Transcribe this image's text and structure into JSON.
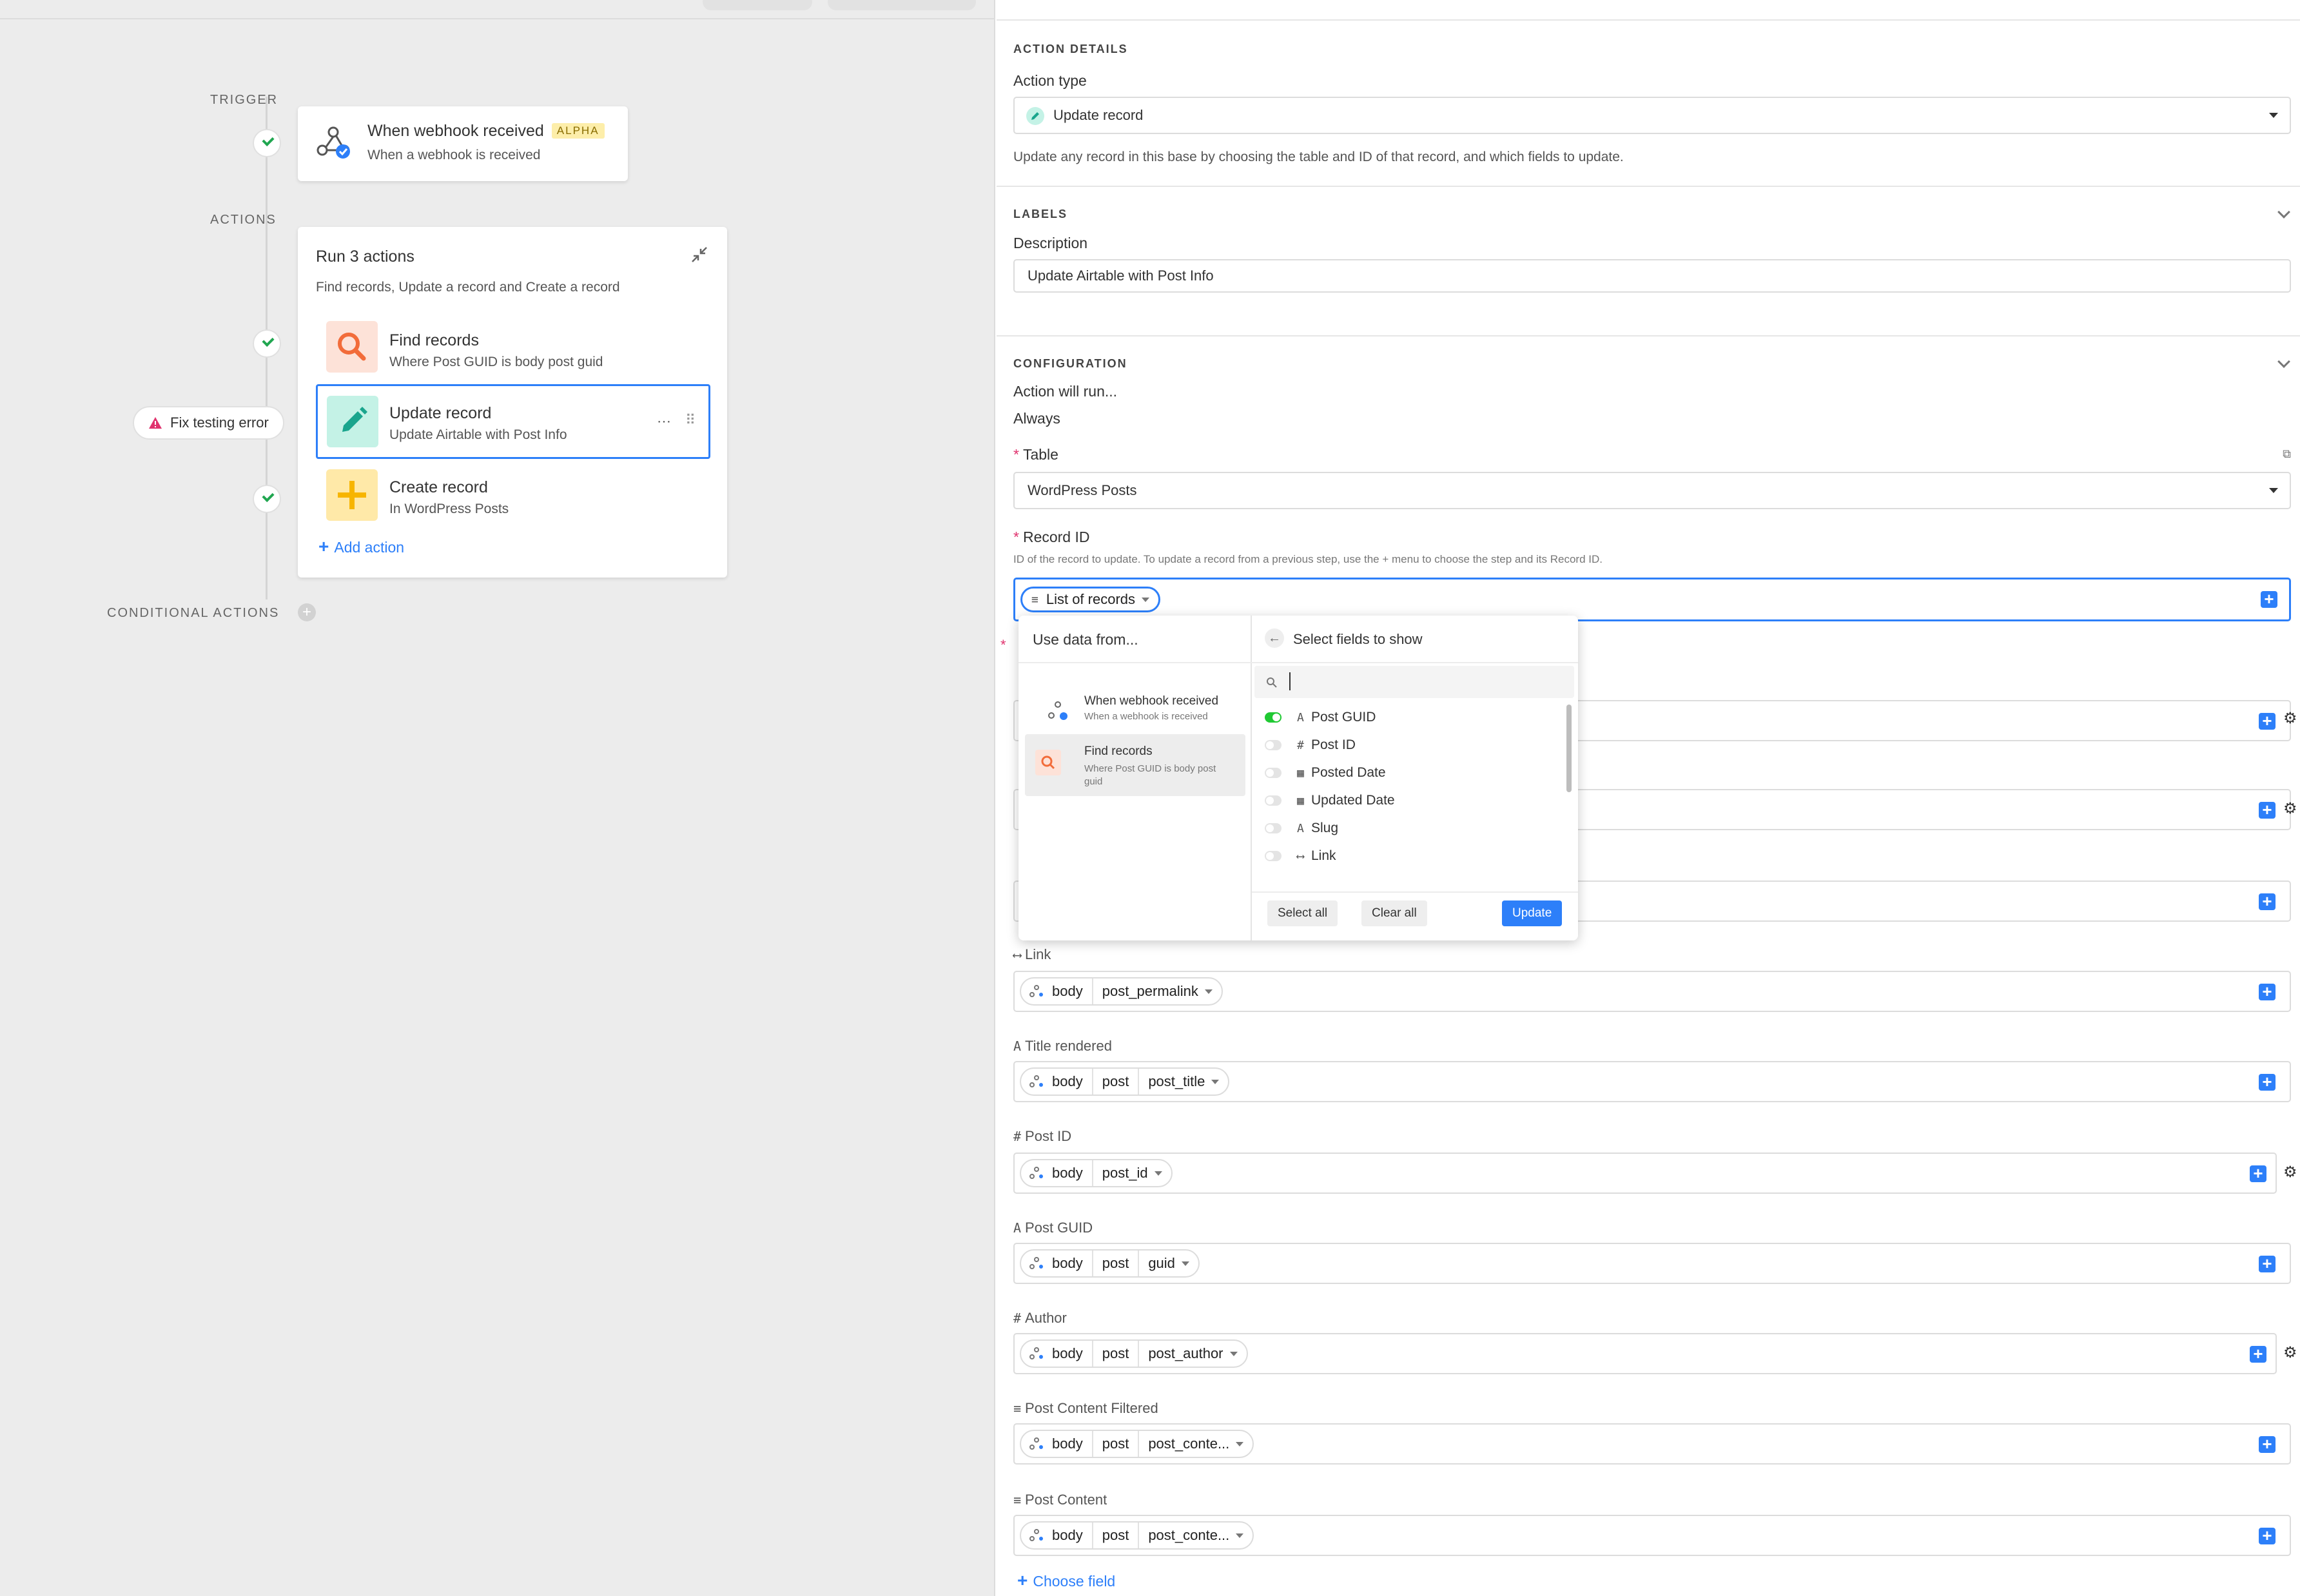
{
  "canvas": {
    "trigger_label": "TRIGGER",
    "actions_label": "ACTIONS",
    "conditional_label": "CONDITIONAL ACTIONS",
    "trigger_card": {
      "title": "When webhook received",
      "badge": "ALPHA",
      "subtitle": "When a webhook is received"
    },
    "group": {
      "title": "Run 3 actions",
      "subtitle": "Find records, Update a record and Create a record",
      "actions": [
        {
          "title": "Find records",
          "subtitle": "Where Post GUID is body post guid",
          "icon": "search-icon",
          "color": "#f26c3a"
        },
        {
          "title": "Update record",
          "subtitle": "Update Airtable with Post Info",
          "icon": "pencil-icon",
          "color": "#1aa58d"
        },
        {
          "title": "Create record",
          "subtitle": "In WordPress Posts",
          "icon": "plus-icon",
          "color": "#f7b500"
        }
      ],
      "add_action": "Add action"
    },
    "error_badge": "Fix testing error"
  },
  "panel": {
    "action_details": {
      "heading": "ACTION DETAILS",
      "action_type_label": "Action type",
      "action_type_value": "Update record",
      "help": "Update any record in this base by choosing the table and ID of that record, and which fields to update."
    },
    "labels": {
      "heading": "LABELS",
      "description_label": "Description",
      "description_value": "Update Airtable with Post Info"
    },
    "configuration": {
      "heading": "CONFIGURATION",
      "runs_label": "Action will run...",
      "runs_value": "Always",
      "table_label": "Table",
      "table_value": "WordPress Posts",
      "record_id_label": "Record ID",
      "record_id_help": "ID of the record to update. To update a record from a previous step, use the + menu to choose the step and its Record ID.",
      "record_id_chip": "List of records"
    },
    "fields": [
      {
        "type_glyph": "⟷",
        "label": "Link",
        "chips": [
          "body",
          "post_permalink"
        ],
        "gear": false
      },
      {
        "type_glyph": "A",
        "label": "Title rendered",
        "chips": [
          "body",
          "post",
          "post_title"
        ],
        "gear": false
      },
      {
        "type_glyph": "#",
        "label": "Post ID",
        "chips": [
          "body",
          "post_id"
        ],
        "gear": true
      },
      {
        "type_glyph": "A",
        "label": "Post GUID",
        "chips": [
          "body",
          "post",
          "guid"
        ],
        "gear": false
      },
      {
        "type_glyph": "#",
        "label": "Author",
        "chips": [
          "body",
          "post",
          "post_author"
        ],
        "gear": true
      },
      {
        "type_glyph": "≡",
        "label": "Post Content Filtered",
        "chips": [
          "body",
          "post",
          "post_conte..."
        ],
        "gear": false
      },
      {
        "type_glyph": "≡",
        "label": "Post Content",
        "chips": [
          "body",
          "post",
          "post_conte..."
        ],
        "gear": false
      }
    ],
    "choose_field": "Choose field"
  },
  "popover": {
    "left_title": "Use data from...",
    "sources": [
      {
        "title": "When webhook received",
        "subtitle": "When a webhook is received"
      },
      {
        "title": "Find records",
        "subtitle": "Where Post GUID is body post guid"
      }
    ],
    "right_title": "Select fields to show",
    "search_value": "",
    "field_options": [
      {
        "glyph": "A",
        "name": "Post GUID",
        "on": true
      },
      {
        "glyph": "#",
        "name": "Post ID",
        "on": false
      },
      {
        "glyph": "▦",
        "name": "Posted Date",
        "on": false
      },
      {
        "glyph": "▦",
        "name": "Updated Date",
        "on": false
      },
      {
        "glyph": "A",
        "name": "Slug",
        "on": false
      },
      {
        "glyph": "⟷",
        "name": "Link",
        "on": false
      }
    ],
    "select_all": "Select all",
    "clear_all": "Clear all",
    "update": "Update"
  }
}
